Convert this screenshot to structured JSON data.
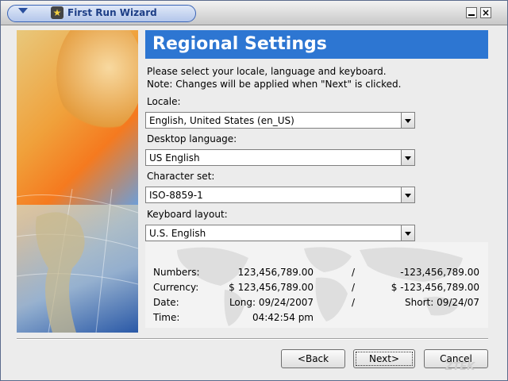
{
  "window": {
    "title": "First Run Wizard"
  },
  "header": {
    "title": "Regional Settings"
  },
  "intro": {
    "line1": "Please select your locale, language and keyboard.",
    "line2": "Note: Changes will be applied when \"Next\" is clicked."
  },
  "fields": {
    "locale": {
      "label": "Locale:",
      "value": "English, United States (en_US)"
    },
    "desktop_language": {
      "label": "Desktop language:",
      "value": "US English"
    },
    "character_set": {
      "label": "Character set:",
      "value": "ISO-8859-1"
    },
    "keyboard_layout": {
      "label": "Keyboard layout:",
      "value": "U.S. English"
    }
  },
  "preview": {
    "numbers": {
      "label": "Numbers:",
      "positive": "123,456,789.00",
      "sep": "/",
      "negative": "-123,456,789.00"
    },
    "currency": {
      "label": "Currency:",
      "positive": "$ 123,456,789.00",
      "sep": "/",
      "negative": "$ -123,456,789.00"
    },
    "date": {
      "label": "Date:",
      "long": "Long: 09/24/2007",
      "sep": "/",
      "short": "Short: 09/24/07"
    },
    "time": {
      "label": "Time:",
      "value": "04:42:54 pm"
    }
  },
  "buttons": {
    "back": "<Back",
    "next": "Next>",
    "cancel": "Cancel"
  },
  "watermark": "ZTEK",
  "colors": {
    "header_bg": "#2d76d2",
    "header_text": "#ffffff",
    "window_bg": "#ececec"
  }
}
